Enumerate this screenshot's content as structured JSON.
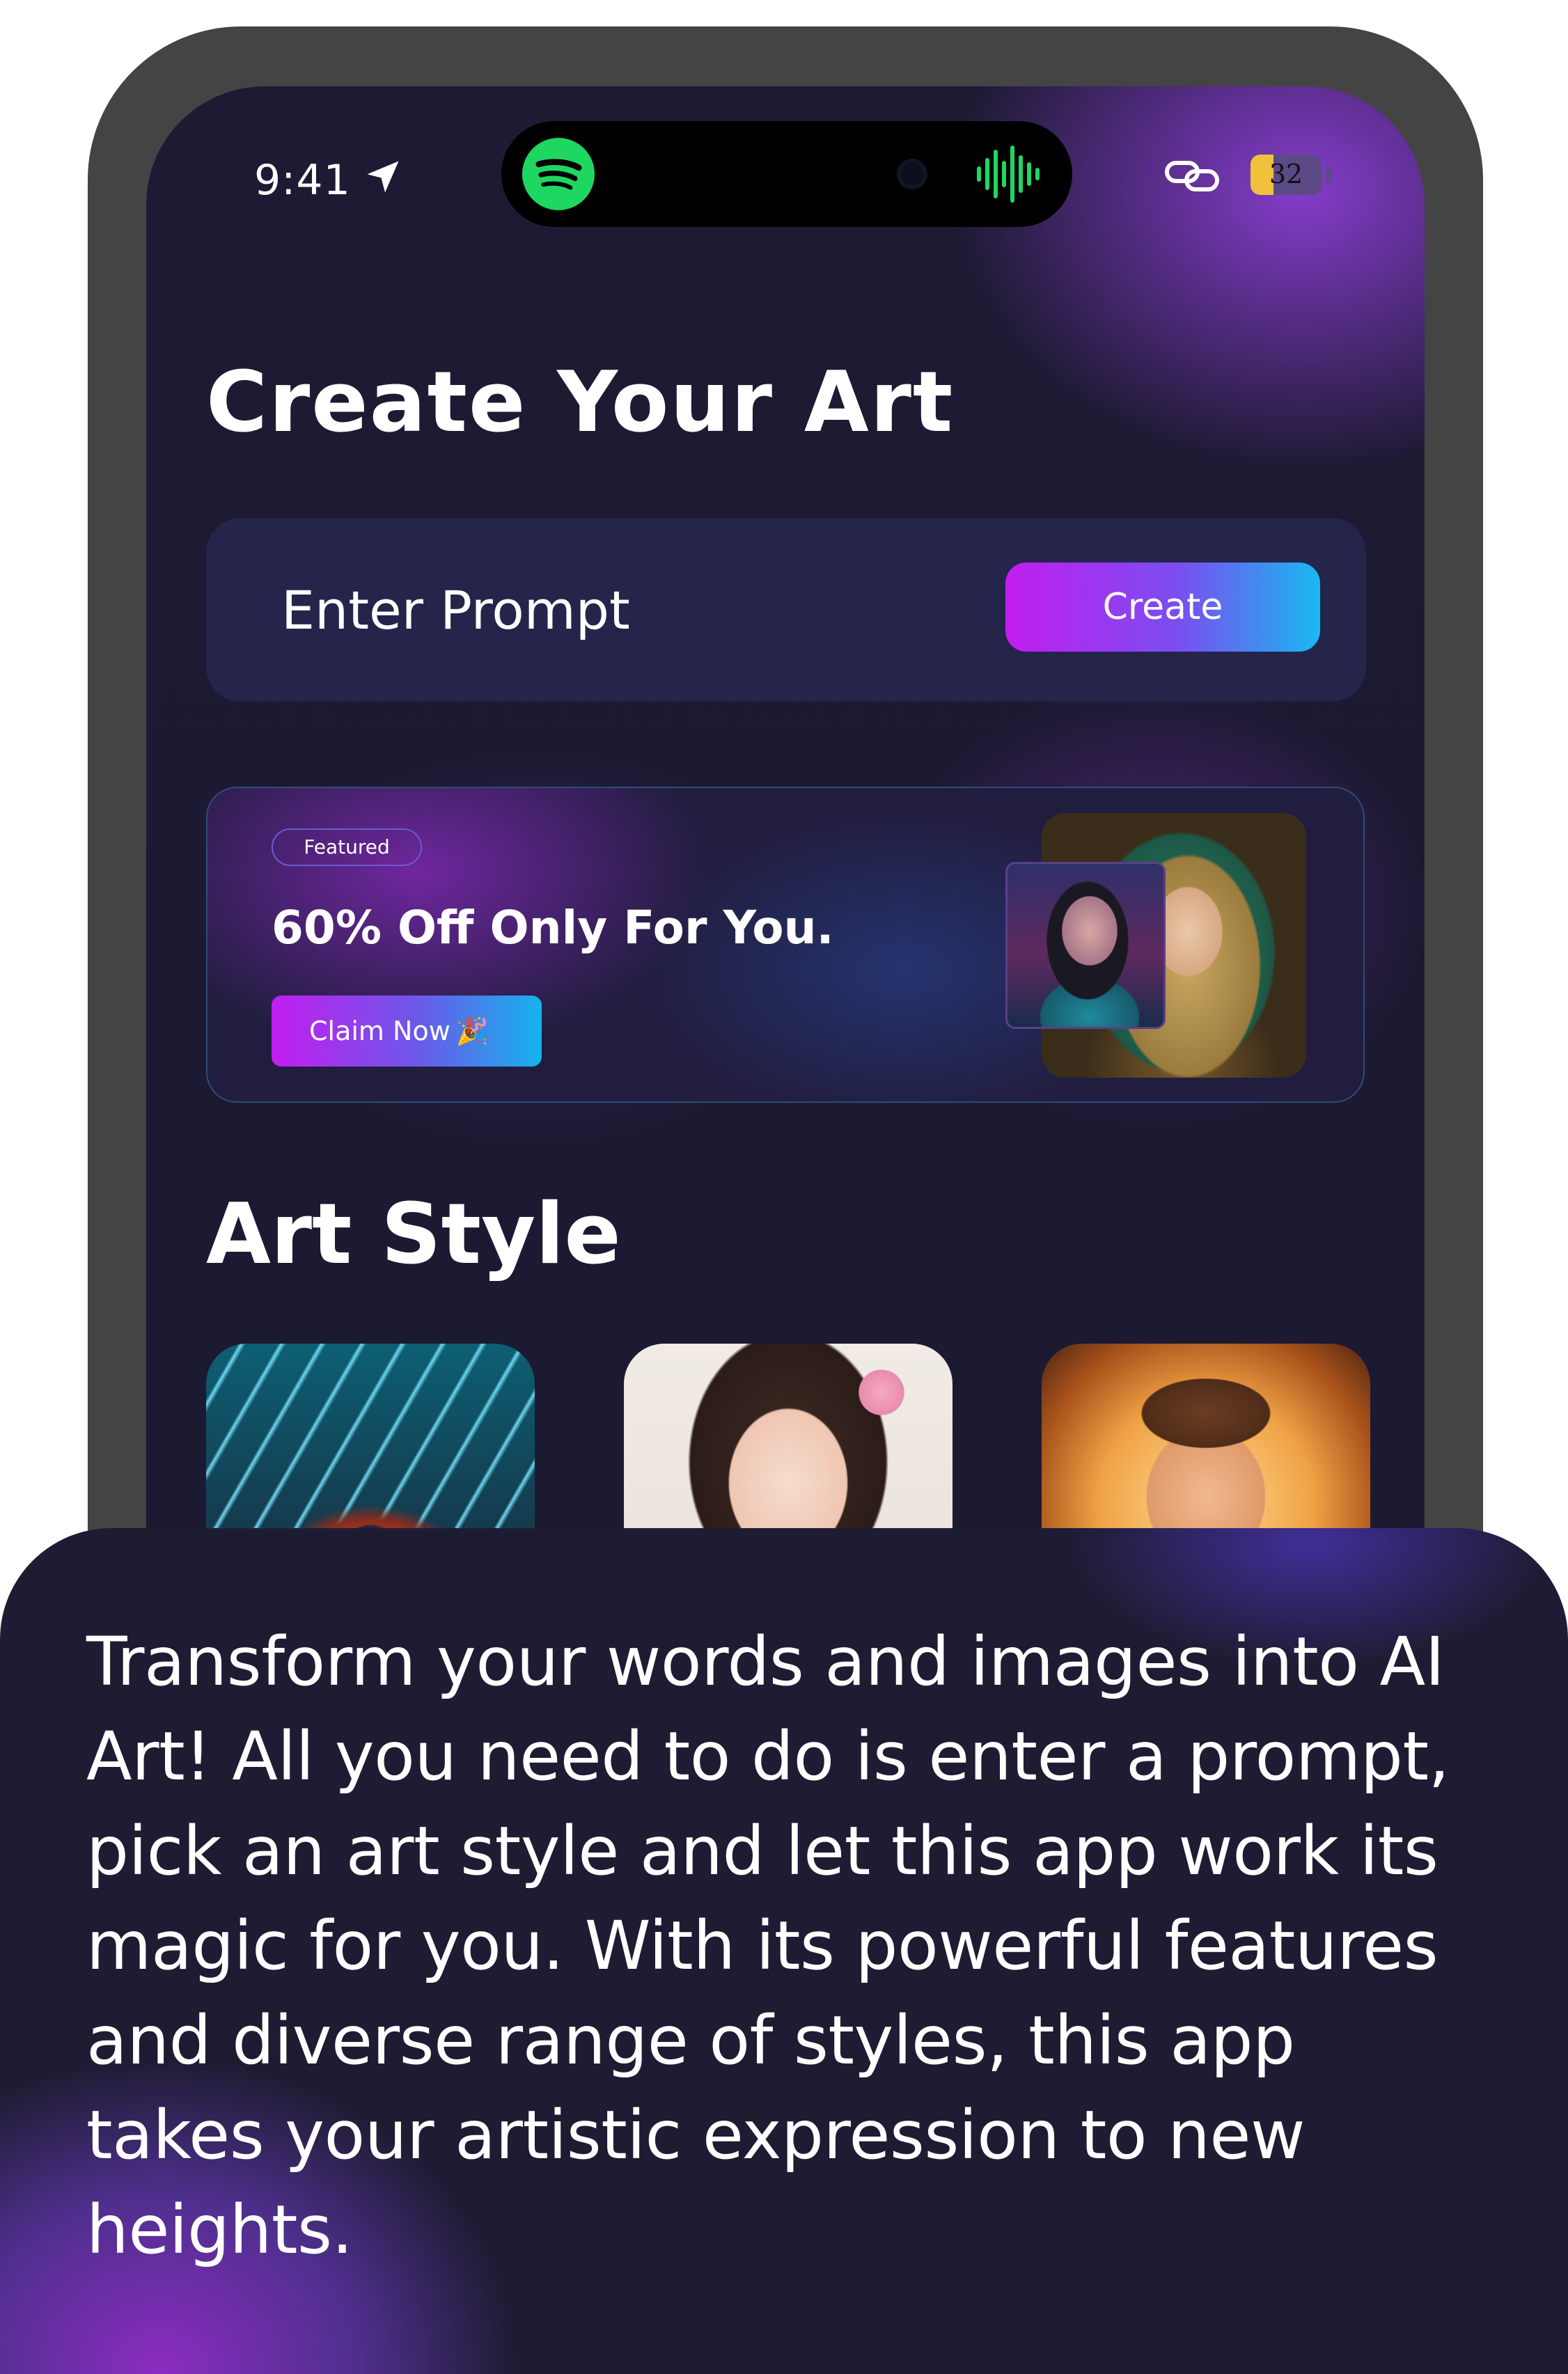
{
  "status_bar": {
    "time": "9:41",
    "battery_label": "32",
    "battery_level": 0.32,
    "icons": [
      "location-arrow-icon",
      "spotify-icon",
      "waveform-icon",
      "link-icon",
      "battery-icon"
    ]
  },
  "header": {
    "title": "Create Your Art"
  },
  "prompt": {
    "placeholder": "Enter Prompt",
    "value": "",
    "create_label": "Create"
  },
  "promo": {
    "badge": "Featured",
    "title": "60% Off Only For You.",
    "cta_label": "Claim Now",
    "cta_icon": "🎉"
  },
  "art_style": {
    "title": "Art Style",
    "items": [
      "sci-fi-corridor-thumbnail",
      "anime-girl-thumbnail",
      "cartoon-cowboy-thumbnail"
    ]
  },
  "description": "Transform your words and images into AI Art! All you need to do is enter a prompt, pick an art style and let this app work its magic for you. With its powerful features and diverse range of styles, this app takes your artistic expression to new heights.",
  "colors": {
    "background": "#1d1a33",
    "accent_purple": "#c21df0",
    "accent_blue": "#18b9f0",
    "spotify_green": "#1ed760",
    "battery_yellow": "#f0c23b"
  }
}
